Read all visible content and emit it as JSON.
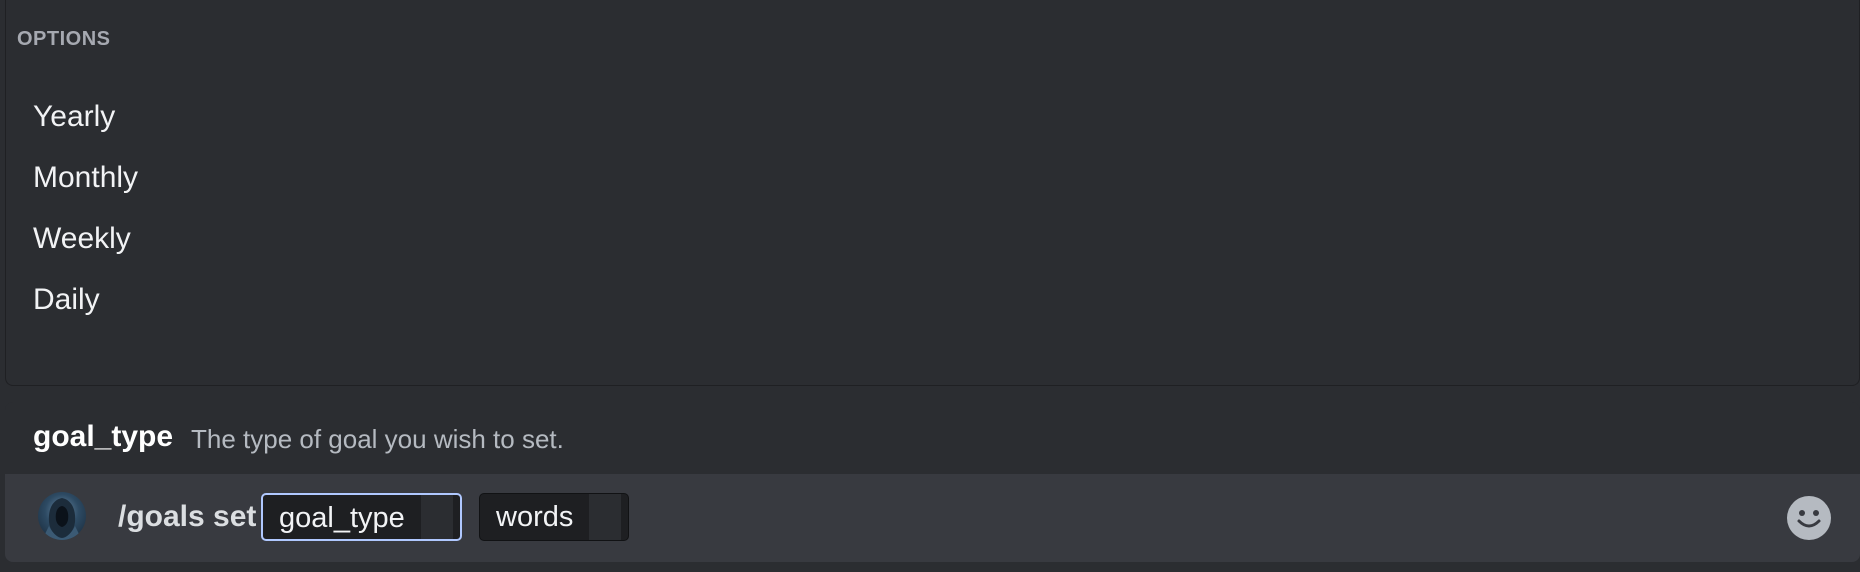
{
  "options": {
    "header": "OPTIONS",
    "items": [
      {
        "label": "Yearly"
      },
      {
        "label": "Monthly"
      },
      {
        "label": "Weekly"
      },
      {
        "label": "Daily"
      }
    ]
  },
  "description": {
    "name": "goal_type",
    "text": "The type of goal you wish to set."
  },
  "input": {
    "command": "/goals set",
    "params": [
      {
        "name": "goal_type",
        "active": true
      },
      {
        "name": "words",
        "active": false
      }
    ]
  },
  "icons": {
    "avatar": "hooded-figure-avatar",
    "emoji": "smiley-face-icon"
  },
  "colors": {
    "background": "#2b2d31",
    "input_bar": "#383a40",
    "active_param_border": "#b0c8ff",
    "muted_text": "#b5bac1"
  }
}
